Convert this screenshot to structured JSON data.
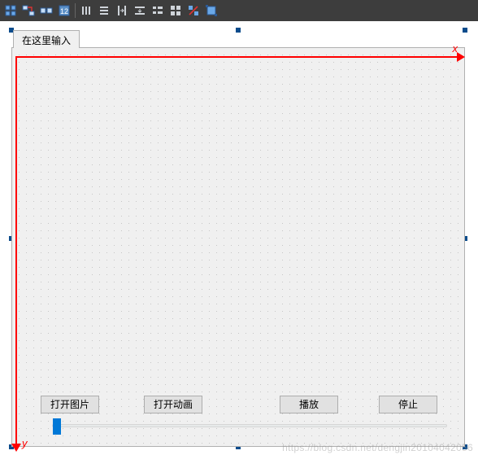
{
  "toolbar": {
    "items": [
      "edit-widgets",
      "edit-signals",
      "edit-buddies",
      "edit-tab-order",
      "sep",
      "layout-h",
      "layout-v",
      "layout-h-splitter",
      "layout-v-splitter",
      "layout-form",
      "layout-grid",
      "break-layout",
      "adjust-size"
    ]
  },
  "tab": {
    "label": "在这里输入"
  },
  "axes": {
    "x": "x",
    "y": "y"
  },
  "buttons": {
    "open_image": "打开图片",
    "open_anim": "打开动画",
    "play": "播放",
    "stop": "停止"
  },
  "watermark": "https://blog.csdn.net/dengjin20104042056",
  "colors": {
    "accent": "#0078d7",
    "axis": "#ff0000"
  }
}
